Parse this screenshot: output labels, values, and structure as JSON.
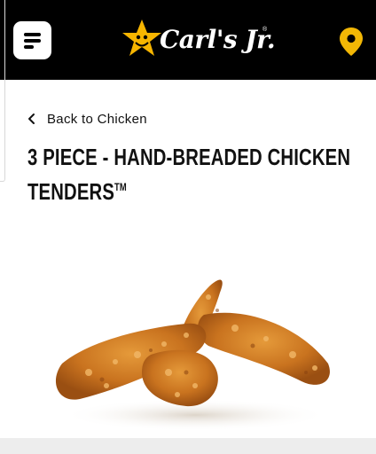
{
  "header": {
    "brand": "Carl's Jr.",
    "registered_mark": "®",
    "menu_icon": "menu-icon",
    "location_icon": "location-pin-icon"
  },
  "nav": {
    "back_label": "Back to Chicken"
  },
  "product": {
    "title": "3 PIECE - HAND-BREADED CHICKEN TENDERS",
    "trademark": "TM"
  },
  "colors": {
    "header_bg": "#000000",
    "star_yellow": "#f7b500",
    "pin_yellow": "#f2b705",
    "title_text": "#111111"
  }
}
